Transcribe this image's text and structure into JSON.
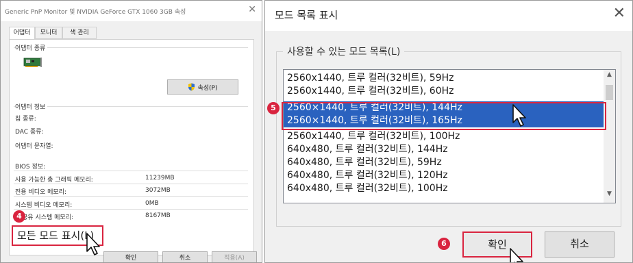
{
  "left_window": {
    "title": "Generic PnP Monitor 및 NVIDIA GeForce GTX 1060 3GB 속성",
    "tabs": [
      {
        "label": "어댑터",
        "active": true
      },
      {
        "label": "모니터",
        "active": false
      },
      {
        "label": "색 관리",
        "active": false
      }
    ],
    "adapter_type_group": "어댑터 종류",
    "properties_button": "속성(P)",
    "adapter_info_group": "어댑터 정보",
    "info_fields": [
      {
        "label": "칩 종류:"
      },
      {
        "label": "DAC 종류:"
      },
      {
        "label": "어댑터 문자열:"
      },
      {
        "label": "BIOS 정보:"
      }
    ],
    "memory_rows": [
      {
        "label": "사용 가능한 총 그래픽 메모리:",
        "value": "11239MB"
      },
      {
        "label": "전용 비디오 메모리:",
        "value": "3072MB"
      },
      {
        "label": "시스템 비디오 메모리:",
        "value": "0MB"
      },
      {
        "label": "공유 시스템 메모리:",
        "value": "8167MB"
      }
    ],
    "all_modes_button": "모든 모드 표시(L)",
    "buttons": {
      "ok": "확인",
      "cancel": "취소",
      "apply": "적용(A)"
    }
  },
  "right_dialog": {
    "title": "모드 목록 표시",
    "list_label": "사용할 수 있는 모드 목록(L)",
    "modes": [
      {
        "text": "2560x1440, 트루 컬러(32비트), 59Hz",
        "selected": false
      },
      {
        "text": "2560x1440, 트루 컬러(32비트), 60Hz",
        "selected": false
      },
      {
        "text": "2560×1440, 트루 컬러(32비트), 144Hz",
        "selected": true
      },
      {
        "text": "2560×1440, 트루 컬러(32비트), 165Hz",
        "selected": true
      },
      {
        "text": "2560x1440, 트루 컬러(32비트), 100Hz",
        "selected": false
      },
      {
        "text": "640x480, 트루 컬러(32비트), 144Hz",
        "selected": false
      },
      {
        "text": "640x480, 트루 컬러(32비트), 59Hz",
        "selected": false
      },
      {
        "text": "640x480, 트루 컬러(32비트), 120Hz",
        "selected": false
      },
      {
        "text": "640x480, 트루 컬러(32비트), 100Hz",
        "selected": false
      }
    ],
    "buttons": {
      "ok": "확인",
      "cancel": "취소"
    }
  },
  "steps": {
    "step4": "4",
    "step5": "5",
    "step6": "6"
  },
  "colors": {
    "highlight": "#d9243f",
    "selection": "#2a62bf"
  },
  "icons": [
    "close-icon",
    "adapter-card-icon",
    "shield-icon",
    "scroll-up-icon",
    "scroll-down-icon",
    "mouse-pointer-icon"
  ]
}
